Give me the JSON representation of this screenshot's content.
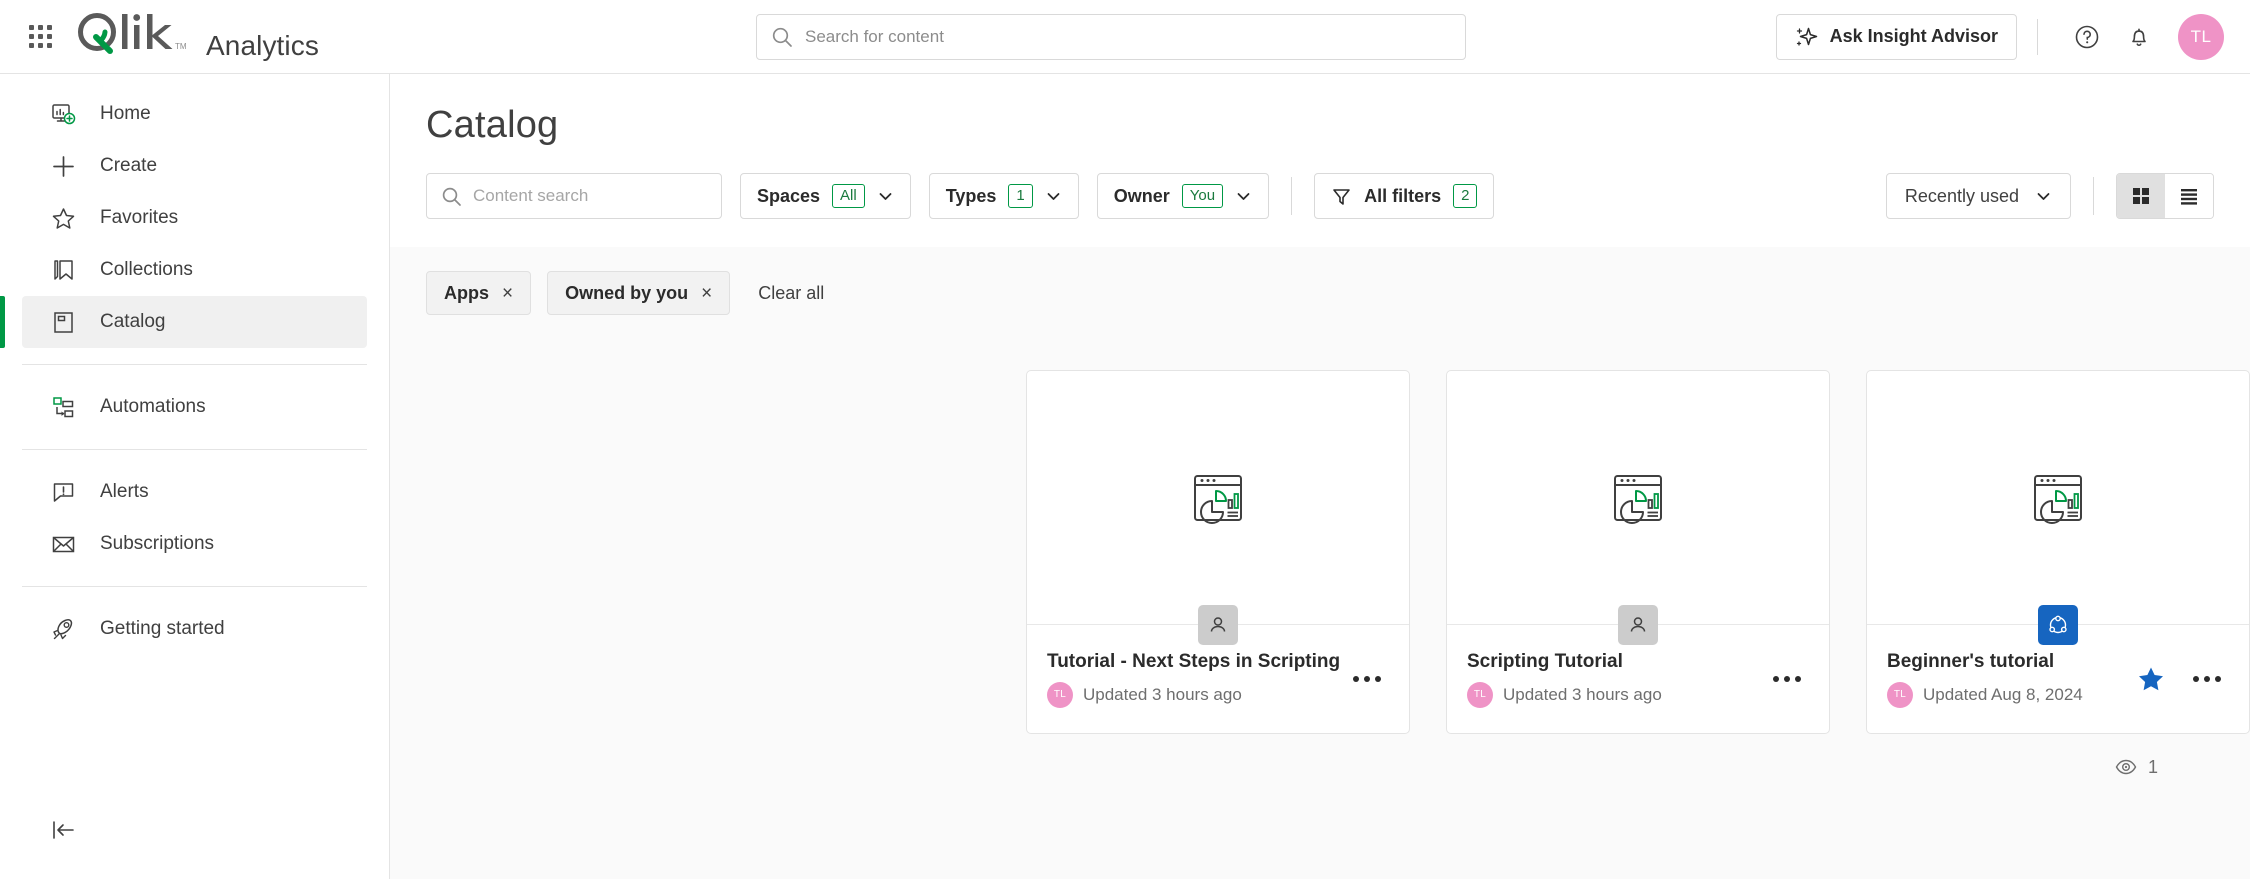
{
  "header": {
    "brand_title": "Analytics",
    "waffle_name": "app-launcher",
    "search": {
      "placeholder": "Search for content",
      "value": ""
    },
    "ask_insight_label": "Ask Insight Advisor",
    "help_icon": "help-circle-icon",
    "notifications_icon": "bell-icon",
    "avatar_initials": "TL"
  },
  "sidebar": {
    "items": [
      {
        "label": "Home",
        "icon": "home-dashboard-icon",
        "active": false
      },
      {
        "label": "Create",
        "icon": "plus-icon",
        "active": false
      },
      {
        "label": "Favorites",
        "icon": "star-outline-icon",
        "active": false
      },
      {
        "label": "Collections",
        "icon": "bookmark-icon",
        "active": false
      },
      {
        "label": "Catalog",
        "icon": "catalog-book-icon",
        "active": true
      },
      {
        "label": "Automations",
        "icon": "automations-flow-icon",
        "active": false
      },
      {
        "label": "Alerts",
        "icon": "alert-bubble-icon",
        "active": false
      },
      {
        "label": "Subscriptions",
        "icon": "envelope-icon",
        "active": false
      },
      {
        "label": "Getting started",
        "icon": "rocket-icon",
        "active": false
      }
    ],
    "collapse_icon": "collapse-sidebar-icon"
  },
  "main": {
    "page_title": "Catalog",
    "toolbar": {
      "content_search": {
        "placeholder": "Content search",
        "value": ""
      },
      "filters": [
        {
          "label": "Spaces",
          "badge": "All",
          "name": "spaces-filter"
        },
        {
          "label": "Types",
          "badge": "1",
          "name": "types-filter"
        },
        {
          "label": "Owner",
          "badge": "You",
          "name": "owner-filter"
        }
      ],
      "all_filters": {
        "label": "All filters",
        "badge": "2",
        "icon": "funnel-icon"
      },
      "sort": {
        "label": "Recently used",
        "icon": "chevron-down-icon"
      },
      "view_grid": {
        "name": "grid-view-toggle",
        "active": true
      },
      "view_list": {
        "name": "list-view-toggle",
        "active": false
      }
    },
    "chips": [
      {
        "label": "Apps",
        "remove": "×"
      },
      {
        "label": "Owned by you",
        "remove": "×"
      }
    ],
    "clear_all_label": "Clear all",
    "cards": [
      {
        "title": "Tutorial - Next Steps in Scripting",
        "updated": "Updated 3 hours ago",
        "owner_initials": "TL",
        "space_type": "personal",
        "space_icon": "person-icon",
        "favorite": false,
        "thumb_icon": "app-chart-icon",
        "more_icon": "more-options-icon"
      },
      {
        "title": "Scripting Tutorial",
        "updated": "Updated 3 hours ago",
        "owner_initials": "TL",
        "space_type": "personal",
        "space_icon": "person-icon",
        "favorite": false,
        "thumb_icon": "app-chart-icon",
        "more_icon": "more-options-icon"
      },
      {
        "title": "Beginner's tutorial",
        "updated": "Updated Aug 8, 2024",
        "owner_initials": "TL",
        "space_type": "shared",
        "space_icon": "shared-space-icon",
        "favorite": true,
        "thumb_icon": "app-chart-icon",
        "more_icon": "more-options-icon"
      }
    ],
    "result_count": "1",
    "result_count_icon": "eye-icon"
  },
  "colors": {
    "brand_green": "#009845",
    "accent_blue": "#1665c0",
    "avatar_pink": "#ef93c6",
    "badge_gray": "#cccccc",
    "text_primary": "#404040"
  }
}
